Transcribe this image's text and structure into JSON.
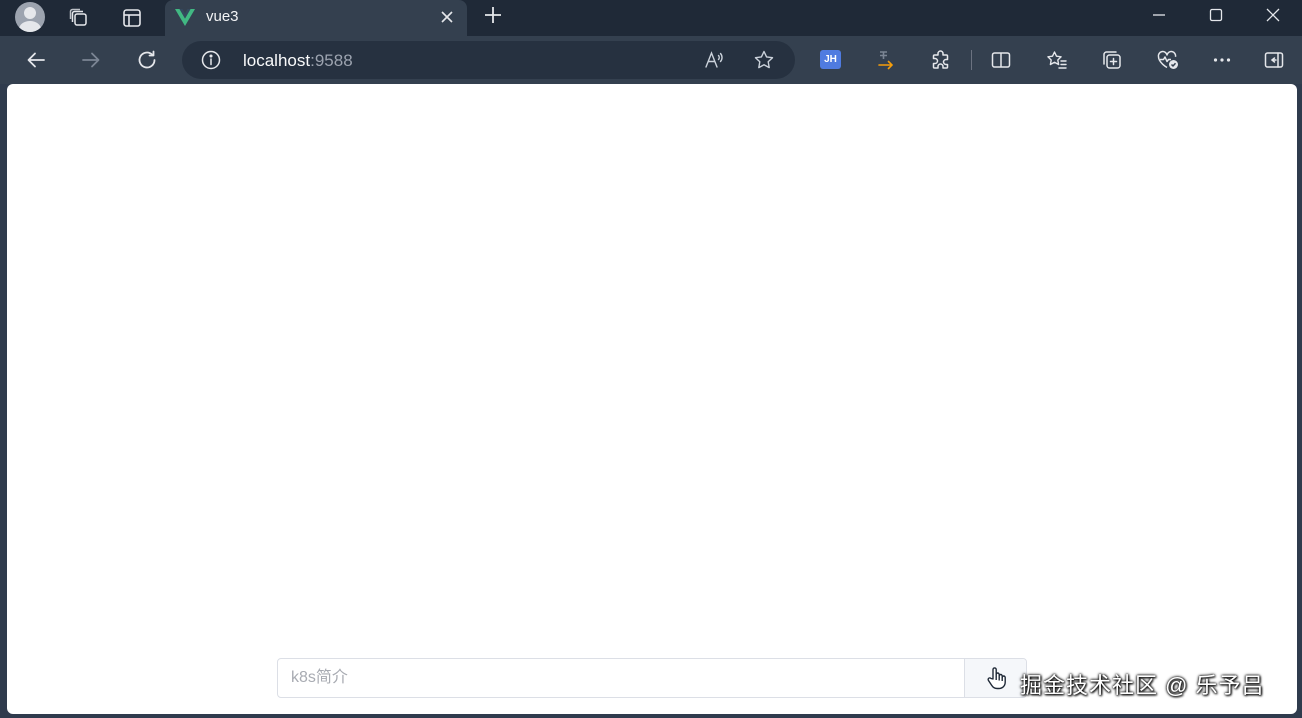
{
  "tab": {
    "title": "vue3",
    "favicon": "vue-logo-icon",
    "accent": "#41b883"
  },
  "address_bar": {
    "host": "localhost",
    "port": ":9588"
  },
  "extensions": {
    "jh_label": "JH",
    "jh_color": "#4f7be0"
  },
  "page": {
    "chat_input": {
      "value": "",
      "placeholder": "k8s简介"
    },
    "send_button_icon": "hand-pointer-icon"
  },
  "overlay": {
    "watermark": "掘金技术社区 @ 乐予吕"
  }
}
